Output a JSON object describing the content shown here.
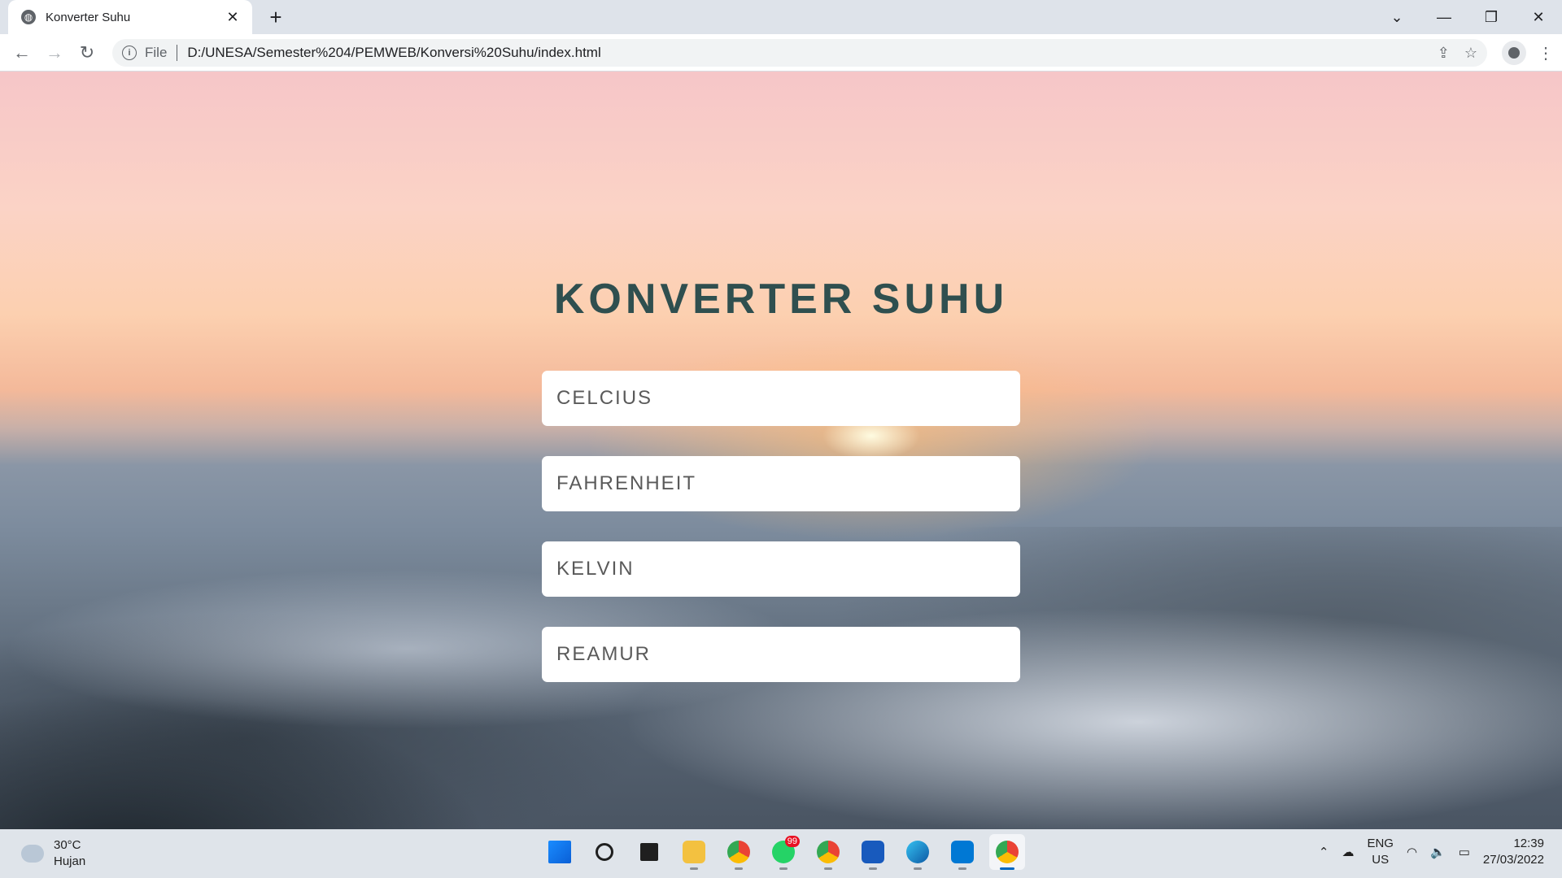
{
  "browser": {
    "tab_title": "Konverter Suhu",
    "tab_close": "✕",
    "new_tab": "+",
    "omnibox_scheme": "File",
    "url": "D:/UNESA/Semester%204/PEMWEB/Konversi%20Suhu/index.html"
  },
  "page": {
    "heading": "KONVERTER SUHU",
    "inputs": [
      {
        "placeholder": "CELCIUS"
      },
      {
        "placeholder": "FAHRENHEIT"
      },
      {
        "placeholder": "KELVIN"
      },
      {
        "placeholder": "REAMUR"
      }
    ]
  },
  "taskbar": {
    "weather_temp": "30°C",
    "weather_desc": "Hujan",
    "whatsapp_badge": "99",
    "lang_line1": "ENG",
    "lang_line2": "US",
    "time": "12:39",
    "date": "27/03/2022",
    "icons": [
      "windows-start",
      "search",
      "task-view",
      "file-explorer",
      "chrome-profile",
      "whatsapp",
      "chrome-profile-2",
      "word",
      "edge",
      "vscode",
      "chrome"
    ]
  }
}
